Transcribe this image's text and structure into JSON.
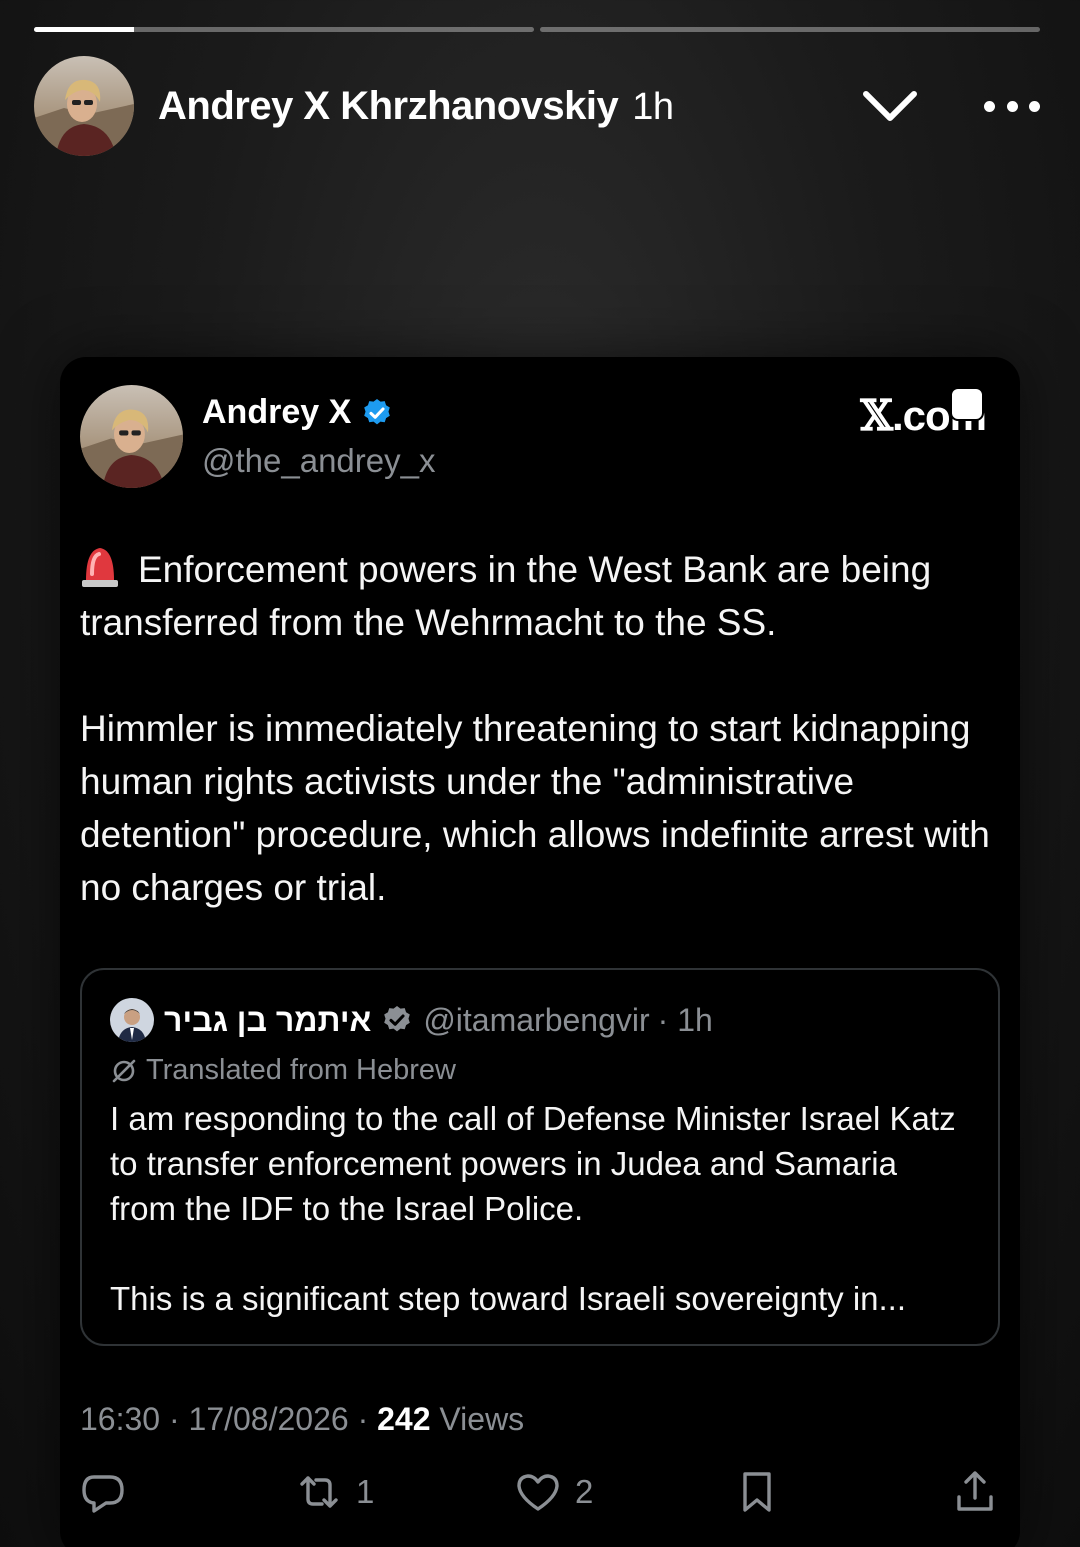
{
  "story": {
    "progress": [
      0.2,
      0.0
    ],
    "username": "Andrey X Khrzhanovskiy",
    "time": "1h",
    "chevron_icon": "chevron-down-icon",
    "more_icon": "more-dots-icon"
  },
  "tweet": {
    "author_name": "Andrey X",
    "author_handle": "@the_andrey_x",
    "source_logo": "X.com",
    "source_logo_rest": ".com",
    "paragraphs": [
      "Enforcement powers in the West Bank are being transferred from the Wehrmacht to the SS.",
      "Himmler is immediately threatening to start kidnapping human rights activists under the \"administrative detention\" procedure, which allows indefinite arrest with no charges or trial."
    ],
    "quote": {
      "name": "איתמר בן גביר",
      "handle": "@itamarbengvir",
      "time": "· 1h",
      "translated_label": "Translated from Hebrew",
      "paragraphs": [
        "I am responding to the call of Defense Minister Israel Katz to transfer enforcement powers in Judea and Samaria from the IDF to the Israel Police.",
        "This is a significant step toward Israeli sovereignty in..."
      ]
    },
    "timestamp": "16:30 · 17/08/2026 ·",
    "views_count": "242",
    "views_label": "Views",
    "actions": {
      "reply_count": "",
      "retweet_count": "1",
      "like_count": "2"
    }
  },
  "colors": {
    "verified": "#1d9bf0",
    "muted": "#8b8f94",
    "card_bg": "#000000"
  }
}
